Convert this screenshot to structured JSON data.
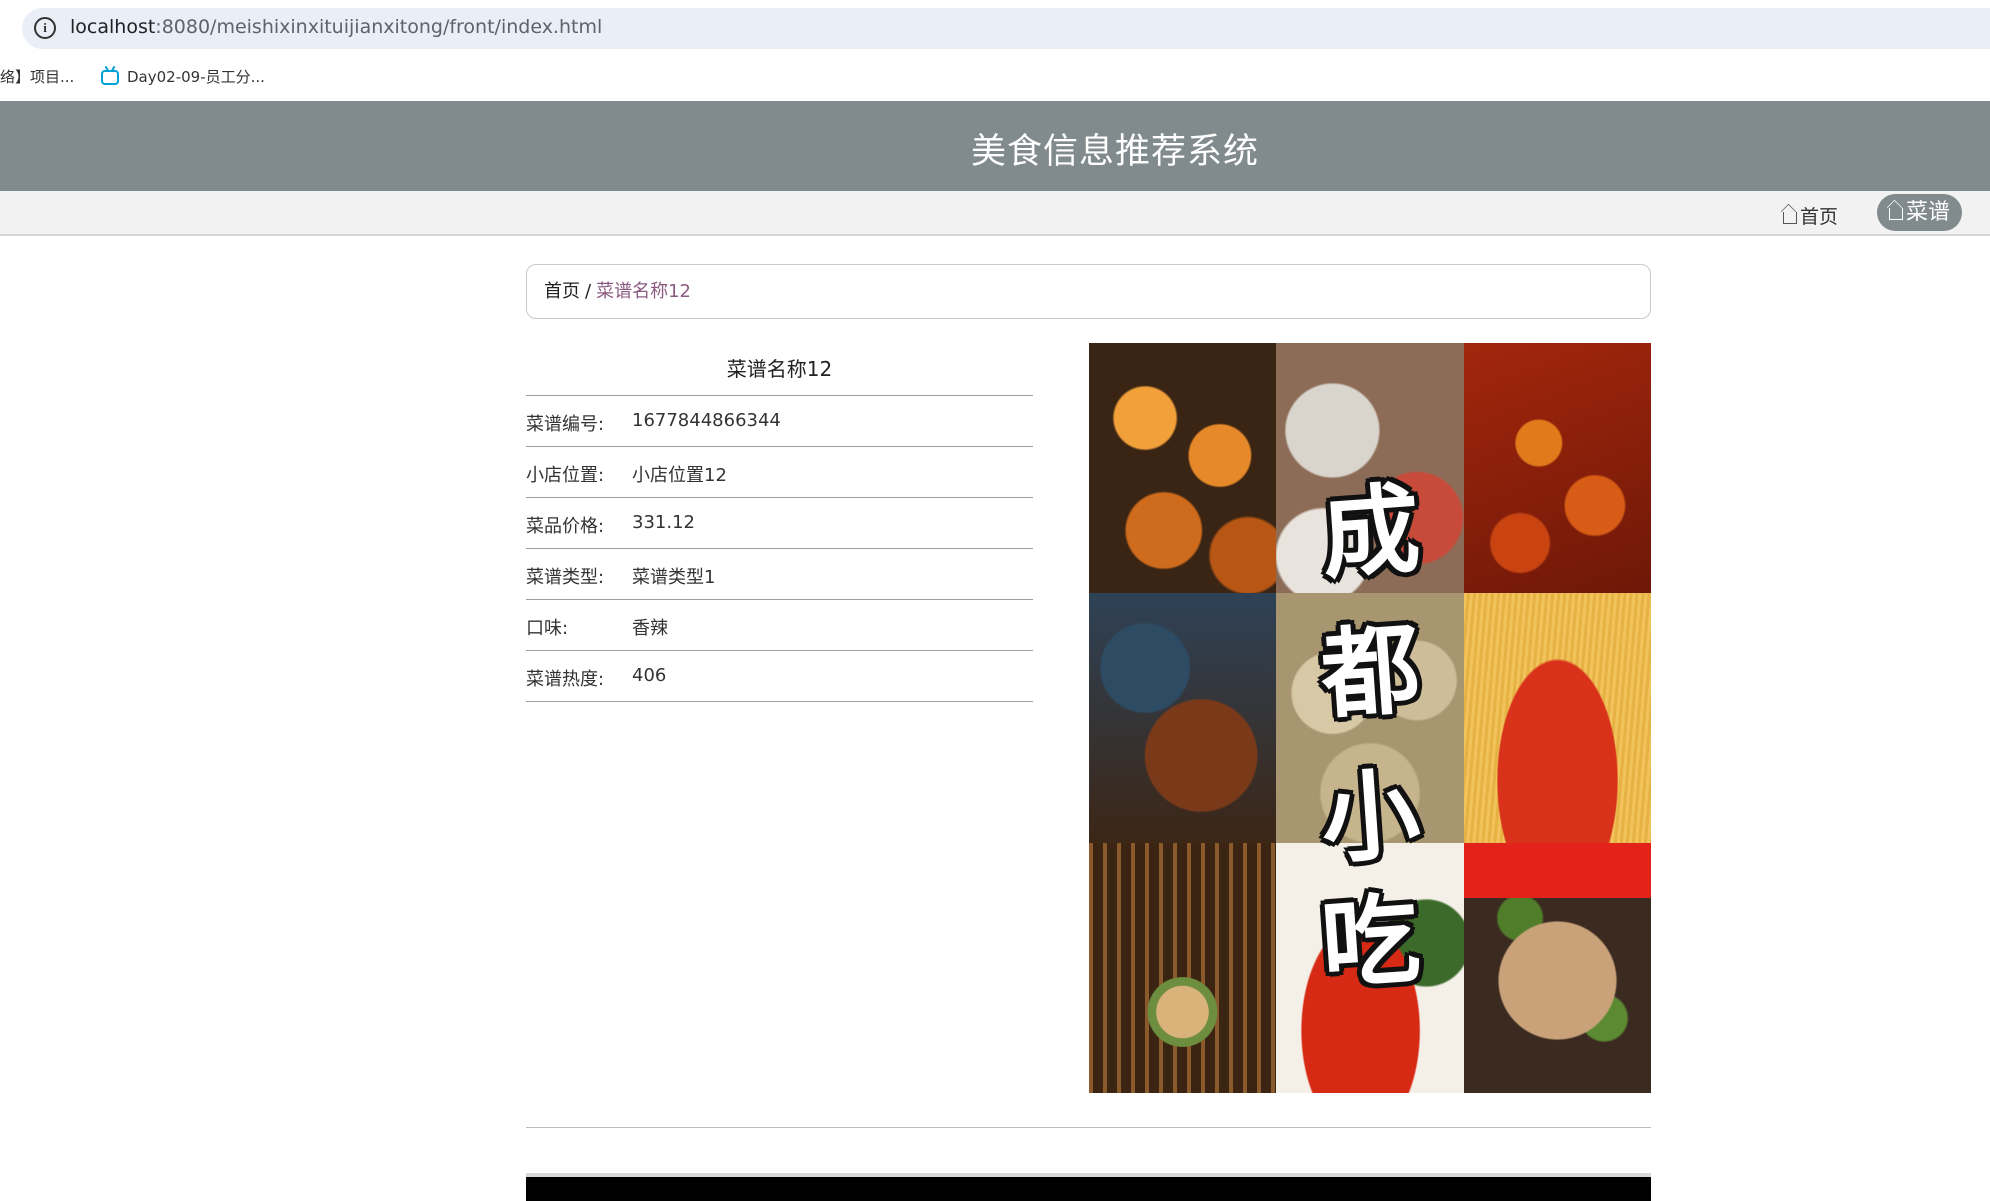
{
  "browser": {
    "url_host": "localhost",
    "url_path": ":8080/meishixinxituijianxitong/front/index.html",
    "bookmarks": [
      {
        "label": "络】项目..."
      },
      {
        "label": "Day02-09-员工分..."
      }
    ]
  },
  "site": {
    "title": "美食信息推荐系统"
  },
  "nav": {
    "home": "首页",
    "recipe": "菜谱"
  },
  "breadcrumb": {
    "home": "首页",
    "separator": "/",
    "current": "菜谱名称12"
  },
  "detail": {
    "title": "菜谱名称12",
    "rows": [
      {
        "label": "菜谱编号:",
        "value": "1677844866344"
      },
      {
        "label": "小店位置:",
        "value": "小店位置12"
      },
      {
        "label": "菜品价格:",
        "value": "331.12"
      },
      {
        "label": "菜谱类型:",
        "value": "菜谱类型1"
      },
      {
        "label": "口味:",
        "value": "香辣"
      },
      {
        "label": "菜谱热度:",
        "value": "406"
      }
    ]
  },
  "image": {
    "overlay_text": [
      "成",
      "都",
      "小",
      "吃"
    ]
  },
  "colors": {
    "header_bg": "#818a8d",
    "breadcrumb_current": "#8b5a80"
  }
}
